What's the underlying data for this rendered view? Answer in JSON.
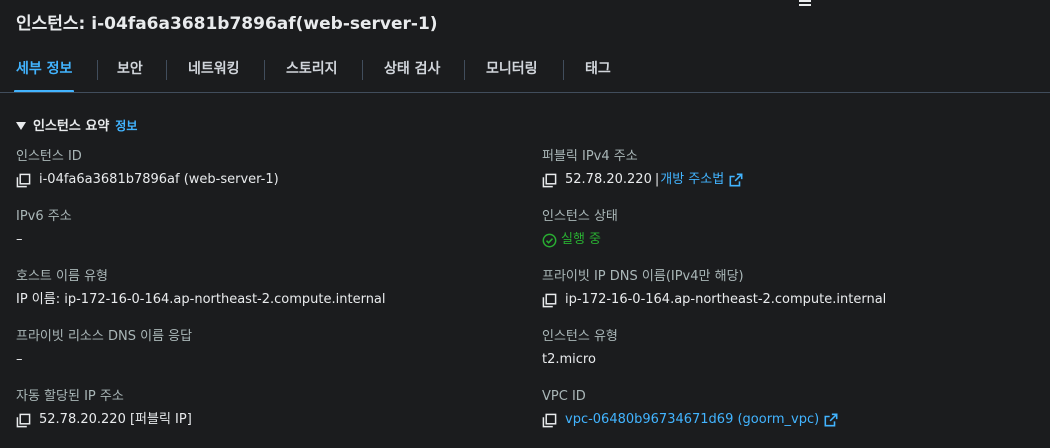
{
  "page": {
    "title": "인스턴스: i-04fa6a3681b7896af(web-server-1)"
  },
  "tabs": [
    {
      "label": "세부 정보",
      "active": true
    },
    {
      "label": "보안"
    },
    {
      "label": "네트워킹"
    },
    {
      "label": "스토리지"
    },
    {
      "label": "상태 검사"
    },
    {
      "label": "모니터링"
    },
    {
      "label": "태그"
    }
  ],
  "section": {
    "title": "인스턴스 요약",
    "info_link": "정보"
  },
  "left": {
    "instance_id": {
      "label": "인스턴스 ID",
      "value": "i-04fa6a3681b7896af (web-server-1)"
    },
    "ipv6": {
      "label": "IPv6 주소",
      "value": "–"
    },
    "hostname_type": {
      "label": "호스트 이름 유형",
      "value": "IP 이름: ip-172-16-0-164.ap-northeast-2.compute.internal"
    },
    "private_dns_answer": {
      "label": "프라이빗 리소스 DNS 이름 응답",
      "value": "–"
    },
    "auto_ip": {
      "label": "자동 할당된 IP 주소",
      "value": "52.78.20.220 [퍼블릭 IP]"
    }
  },
  "right": {
    "public_ipv4": {
      "label": "퍼블릭 IPv4 주소",
      "value": "52.78.20.220",
      "sep": "|",
      "link": "개방 주소법"
    },
    "state": {
      "label": "인스턴스 상태",
      "value": "실행 중"
    },
    "private_dns": {
      "label": "프라이빗 IP DNS 이름(IPv4만 해당)",
      "value": "ip-172-16-0-164.ap-northeast-2.compute.internal"
    },
    "instance_type": {
      "label": "인스턴스 유형",
      "value": "t2.micro"
    },
    "vpc": {
      "label": "VPC ID",
      "value": "vpc-06480b96734671d69 (goorm_vpc)"
    }
  },
  "colors": {
    "accent": "#42b4ff",
    "success": "#29ad32",
    "background": "#1b1c1e"
  }
}
